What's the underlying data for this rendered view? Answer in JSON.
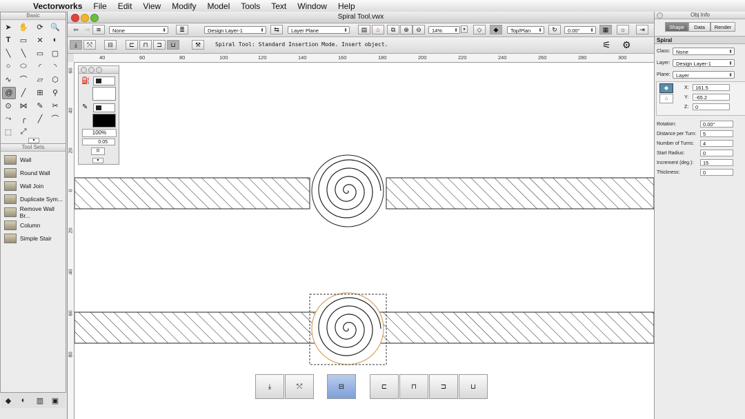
{
  "menubar": {
    "app": "Vectorworks",
    "items": [
      "File",
      "Edit",
      "View",
      "Modify",
      "Model",
      "Tools",
      "Text",
      "Window",
      "Help"
    ]
  },
  "palettes": {
    "basic_title": "Basic",
    "toolsets_title": "Tool Sets",
    "toolset_items": [
      "Wall",
      "Round Wall",
      "Wall Join",
      "Duplicate Sym...",
      "Remove Wall Br...",
      "Column",
      "Simple Stair"
    ]
  },
  "document": {
    "title": "Spiral Tool.vwx",
    "class_dd": "None",
    "layer_dd": "Design Layer-1",
    "plane_dd": "Layer Plane",
    "zoom": "14%",
    "view_dd": "Top/Plan",
    "rotation": "0.00°",
    "help_text": "Spiral Tool: Standard Insertion Mode. Insert object."
  },
  "rulers": {
    "h": [
      "40",
      "60",
      "80",
      "100",
      "120",
      "140",
      "160",
      "180",
      "200",
      "220",
      "240",
      "260",
      "280",
      "300"
    ],
    "v": [
      "60",
      "40",
      "20",
      "0",
      "20",
      "40",
      "60",
      "80"
    ]
  },
  "attributes": {
    "opacity": "100%",
    "line_weight": "0.05"
  },
  "objinfo": {
    "title": "Obj Info",
    "tabs": [
      "Shape",
      "Data",
      "Render"
    ],
    "object_type": "Spiral",
    "class_label": "Class:",
    "class_value": "None",
    "layer_label": "Layer:",
    "layer_value": "Design Layer-1",
    "plane_label": "Plane:",
    "plane_value": "Layer",
    "x_label": "X:",
    "x_value": "161.5",
    "y_label": "Y:",
    "y_value": "-65.2",
    "z_label": "Z:",
    "z_value": "0",
    "rotation_label": "Rotation:",
    "rotation_value": "0.00°",
    "dist_label": "Distance per Turn:",
    "dist_value": "5",
    "turns_label": "Number of Turns:",
    "turns_value": "4",
    "radius_label": "Start Radius:",
    "radius_value": "0",
    "inc_label": "Increment (deg.):",
    "inc_value": "15",
    "thick_label": "Thickness:",
    "thick_value": "0"
  },
  "colors": {
    "selection_orange": "#d8a060",
    "mode_selected": "#8fadde"
  }
}
